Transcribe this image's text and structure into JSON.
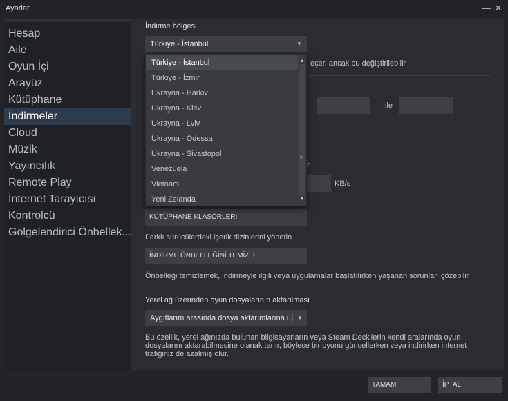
{
  "window": {
    "title": "Ayarlar",
    "minimize_glyph": "—",
    "close_glyph": "✕"
  },
  "sidebar": {
    "items": [
      {
        "label": "Hesap"
      },
      {
        "label": "Aile"
      },
      {
        "label": "Oyun İçi"
      },
      {
        "label": "Arayüz"
      },
      {
        "label": "Kütüphane"
      },
      {
        "label": "İndirmeler",
        "active": true
      },
      {
        "label": "Cloud"
      },
      {
        "label": "Müzik"
      },
      {
        "label": "Yayıncılık"
      },
      {
        "label": "Remote Play"
      },
      {
        "label": "İnternet Tarayıcısı"
      },
      {
        "label": "Kontrolcü"
      },
      {
        "label": "Gölgelendirici Önbellek..."
      }
    ]
  },
  "download_region": {
    "label": "İndirme bölgesi",
    "selected": "Türkiye - İstanbul",
    "note_partial": "eçer, ancak bu değiştirilebilir",
    "options": [
      "Türkiye - İstanbul",
      "Türkiye - İzmir",
      "Ukrayna - Harkiv",
      "Ukrayna - Kiev",
      "Ukrayna - Lviv",
      "Ukrayna - Odessa",
      "Ukrayna - Sivastopol",
      "Venezuela",
      "Vietnam",
      "Yeni Zelanda"
    ]
  },
  "schedule": {
    "between_word": "ile"
  },
  "bandwidth": {
    "partial_label": "r",
    "unit": "KB/s"
  },
  "library_folders": {
    "button_label": "KÜTÜPHANE KLASÖRLERİ",
    "description": "Farklı sürücülerdeki içerik dizinlerini yönetin"
  },
  "clear_cache": {
    "button_label": "İNDİRME ÖNBELLEĞİNİ TEMİZLE",
    "description": "Önbelleği temizlemek, indirmeyle ilgili veya uygulamalar başlatılırken yaşanan sorunları çözebilir"
  },
  "lan_transfer": {
    "label": "Yerel ağ üzerinden oyun dosyalarının aktarılması",
    "selected": "Aygıtlarım arasında dosya aktarımlarına i...",
    "description_line1": "Bu özellik, yerel ağınızda bulunan bilgisayarların veya Steam Deck'lerin kendi aralarında oyun",
    "description_line2": "dosyalarını aktarabilmesine olanak tanır, böylece bir oyunu güncellerken veya indirirken internet",
    "description_line3": "trafiğiniz de azalmış olur."
  },
  "footer": {
    "ok_label": "TAMAM",
    "cancel_label": "İPTAL"
  },
  "icons": {
    "chevron_down": "▼",
    "chevron_up": "▲",
    "grip": "⠿"
  }
}
